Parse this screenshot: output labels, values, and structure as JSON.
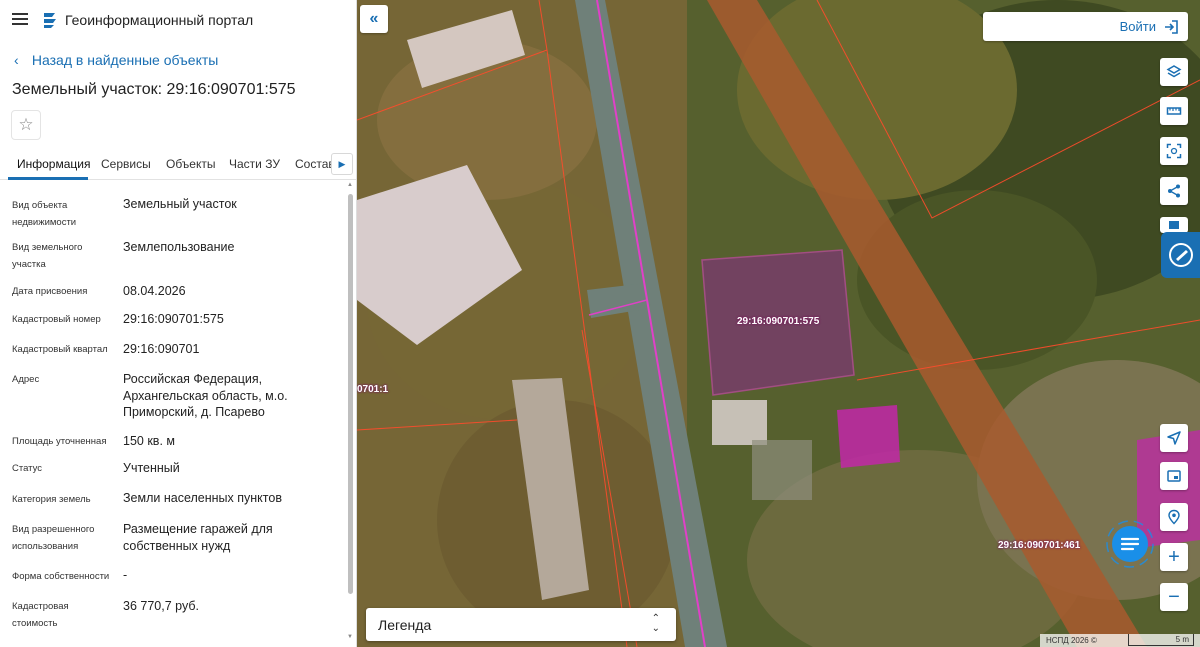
{
  "header": {
    "portal_title": "Геоинформационный портал"
  },
  "nav": {
    "back_label": "Назад в найденные объекты"
  },
  "object": {
    "title": "Земельный участок: 29:16:090701:575"
  },
  "tabs": [
    {
      "label": "Информация",
      "active": true
    },
    {
      "label": "Сервисы"
    },
    {
      "label": "Объекты"
    },
    {
      "label": "Части ЗУ"
    },
    {
      "label": "Состав"
    }
  ],
  "properties": [
    {
      "label": "Вид объекта недвижимости",
      "value": "Земельный участок"
    },
    {
      "label": "Вид земельного участка",
      "value": "Землепользование"
    },
    {
      "label": "Дата присвоения",
      "value": "08.04.2026"
    },
    {
      "label": "Кадастровый номер",
      "value": "29:16:090701:575"
    },
    {
      "label": "Кадастровый квартал",
      "value": "29:16:090701"
    },
    {
      "label": "Адрес",
      "value": "Российская Федерация, Архангельская область, м.о. Приморский, д. Псарево"
    },
    {
      "label": "Площадь уточненная",
      "value": "150 кв. м"
    },
    {
      "label": "Статус",
      "value": "Учтенный"
    },
    {
      "label": "Категория земель",
      "value": "Земли населенных пунктов"
    },
    {
      "label": "Вид разрешенного использования",
      "value": "Размещение гаражей для собственных нужд"
    },
    {
      "label": "Форма собственности",
      "value": "-"
    },
    {
      "label": "Кадастровая стоимость",
      "value": "36 770,7 руб."
    }
  ],
  "map": {
    "login_label": "Войти",
    "legend_label": "Легенда",
    "parcel_labels": [
      "29:16:090701:575",
      "29:16:090701:461",
      "0701:1"
    ],
    "attribution": "НСПД 2026 ©",
    "scale_label": "5 m"
  },
  "colors": {
    "accent": "#1a6fb3",
    "parcel_border": "#e040c8",
    "boundary": "#ff4b2b"
  }
}
